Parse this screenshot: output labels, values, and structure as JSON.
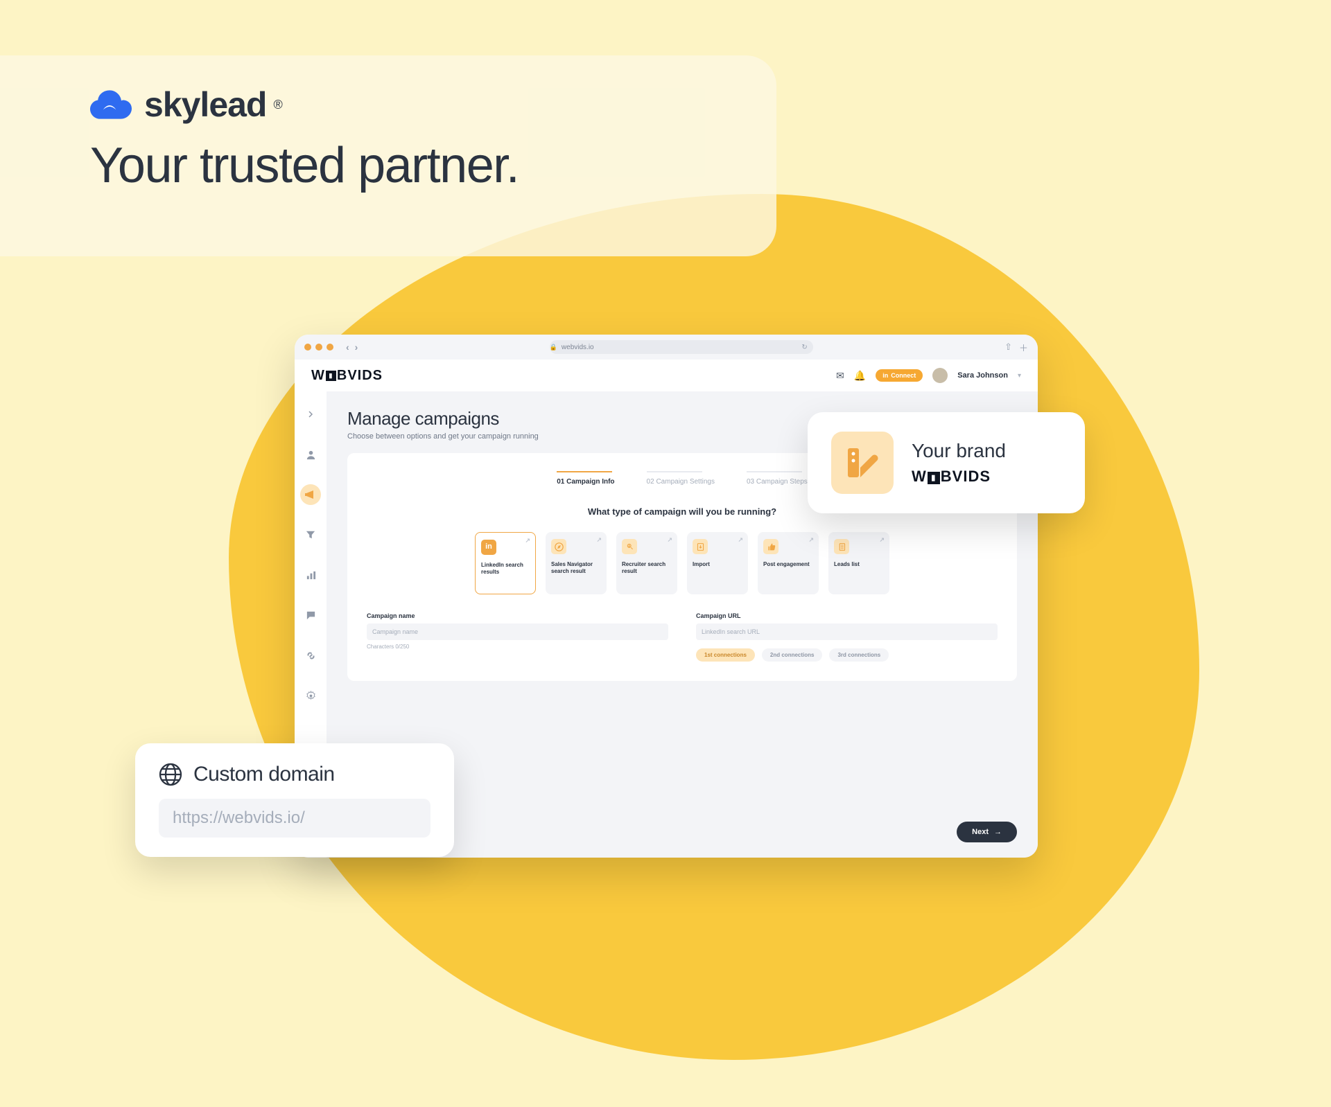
{
  "hero": {
    "brand": "skylead",
    "tagline": "Your trusted partner."
  },
  "browser": {
    "url": "webvids.io",
    "brand": "WEBVIDS",
    "connect": "Connect",
    "user": "Sara Johnson"
  },
  "sidebar": {
    "items": [
      {
        "name": "chevron",
        "label": "›"
      },
      {
        "name": "user",
        "label": "person"
      },
      {
        "name": "campaigns",
        "label": "megaphone",
        "active": true
      },
      {
        "name": "filter",
        "label": "funnel"
      },
      {
        "name": "stats",
        "label": "bars"
      },
      {
        "name": "chat",
        "label": "chat"
      },
      {
        "name": "link",
        "label": "link"
      },
      {
        "name": "settings",
        "label": "gear"
      }
    ]
  },
  "page": {
    "title": "Manage campaigns",
    "subtitle": "Choose between options and get your campaign running"
  },
  "steps": [
    {
      "num": "01",
      "label": "Campaign Info",
      "active": true
    },
    {
      "num": "02",
      "label": "Campaign Settings",
      "active": false
    },
    {
      "num": "03",
      "label": "Campaign Steps",
      "active": false
    }
  ],
  "prompt": "What type of campaign will you be running?",
  "types": [
    {
      "id": "linkedin",
      "label": "LinkedIn search results",
      "selected": true,
      "color": "#f0a644",
      "bg": "#fde4b8"
    },
    {
      "id": "salesnav",
      "label": "Sales Navigator search result",
      "color": "#f0a644",
      "bg": "#fde4b8"
    },
    {
      "id": "recruiter",
      "label": "Recruiter search result",
      "color": "#f0a644",
      "bg": "#fde4b8"
    },
    {
      "id": "import",
      "label": "Import",
      "color": "#f0a644",
      "bg": "#fde4b8"
    },
    {
      "id": "post",
      "label": "Post engagement",
      "color": "#f0a644",
      "bg": "#fde4b8"
    },
    {
      "id": "leads",
      "label": "Leads list",
      "color": "#f0a644",
      "bg": "#fde4b8"
    }
  ],
  "form": {
    "name_label": "Campaign name",
    "name_placeholder": "Campaign name",
    "name_hint": "Characters 0/250",
    "url_label": "Campaign URL",
    "url_placeholder": "LinkedIn search URL",
    "pills": [
      {
        "label": "1st connections",
        "on": true
      },
      {
        "label": "2nd connections",
        "on": false
      },
      {
        "label": "3rd connections",
        "on": false
      }
    ]
  },
  "next": "Next",
  "callouts": {
    "domain": {
      "title": "Custom domain",
      "value": "https://webvids.io/"
    },
    "brand": {
      "title": "Your brand",
      "value": "WEBVIDS"
    }
  }
}
